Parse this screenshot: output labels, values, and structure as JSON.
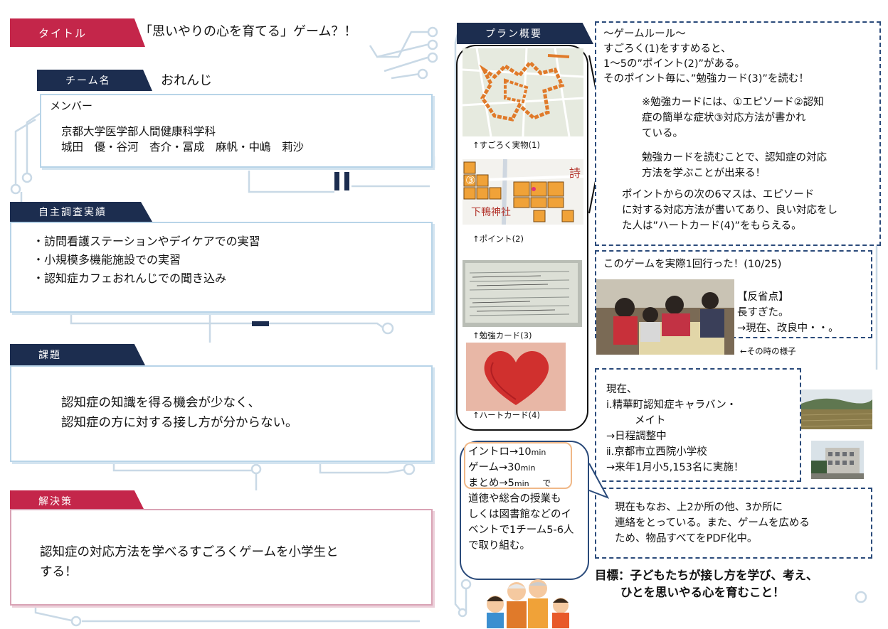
{
  "title": {
    "label": "タイトル",
    "value": "「思いやりの心を育てる」ゲーム？！"
  },
  "team": {
    "label": "チーム名",
    "value": "おれんじ",
    "members_heading": "メンバー",
    "affiliation": "京都大学医学部人間健康科学科",
    "names": "城田　優・谷河　杏介・冨成　麻帆・中嶋　莉沙"
  },
  "research": {
    "label": "自主調査実績",
    "items": [
      "・訪問看護ステーションやデイケアでの実習",
      "・小規模多機能施設での実習",
      "・認知症カフェおれんじでの聞き込み"
    ]
  },
  "issue": {
    "label": "課題",
    "lines": [
      "認知症の知識を得る機会が少なく、",
      "認知症の方に対する接し方が分からない。"
    ]
  },
  "solution": {
    "label": "解決策",
    "lines": [
      "認知症の対応方法を学べるすごろくゲームを小学生と",
      "する！"
    ]
  },
  "plan": {
    "label": "プラン概要",
    "captions": {
      "board": "↑すごろく実物(1)",
      "point": "↑ポイント(2)",
      "card": "↑勉強カード(3)",
      "heart": "↑ハートカード(4)",
      "scene": "←その時の様子"
    },
    "point_image": {
      "number": "③",
      "shrine": "下鴨神社",
      "corner": "詩"
    },
    "rules": {
      "heading": "～ゲームルール～",
      "lines": [
        "すごろく(1)をすすめると、",
        "1～5の”ポイント(2)”がある。",
        "そのポイント毎に、”勉強カード(3)”を読む！"
      ],
      "note_lines": [
        "※勉強カードには、①エピソード②認知",
        "症の簡単な症状③対応方法が書かれ",
        "ている。"
      ],
      "learn_lines": [
        "勉強カードを読むことで、認知症の対応",
        "方法を学ぶことが出来る！"
      ],
      "heart_lines": [
        "ポイントからの次の6マスは、エピソード",
        "に対する対応方法が書いてあり、良い対応をし",
        "た人は”ハートカード(4)”をもらえる。"
      ]
    },
    "trial": {
      "heading": "このゲームを実際1回行った！(10/25)",
      "lines": [
        "【反省点】",
        "長すぎた。",
        "→現在、改良中・・。"
      ]
    },
    "current": {
      "lines": [
        "現在、",
        "ⅰ.精華町認知症キャラバン・",
        "メイト",
        "→日程調整中",
        "ⅱ.京都市立西院小学校",
        "→来年1月小5,153名に実施！"
      ]
    },
    "contact": {
      "lines": [
        "現在もなお、上2か所の他、3か所に",
        "連絡をとっている。また、ゲームを広める",
        "ため、物品すべてをPDF化中。"
      ]
    },
    "schedule": {
      "intro": "イントロ→10",
      "game": "ゲーム→30",
      "summary": "まとめ→5",
      "unit": "min",
      "de": "で",
      "lines": [
        "道徳や総合の授業も",
        "しくは図書館などのイ",
        "ベントで1チーム5-6人",
        "で取り組む。"
      ]
    },
    "goal": {
      "line1": "目標：子どもたちが接し方を学び、考え、",
      "line2": "ひとを思いやる心を育むこと！"
    }
  },
  "colors": {
    "navy": "#1c2d4f",
    "red": "#c4264a",
    "frame_blue": "#b8d4e8",
    "dash_blue": "#2a4a7a"
  }
}
